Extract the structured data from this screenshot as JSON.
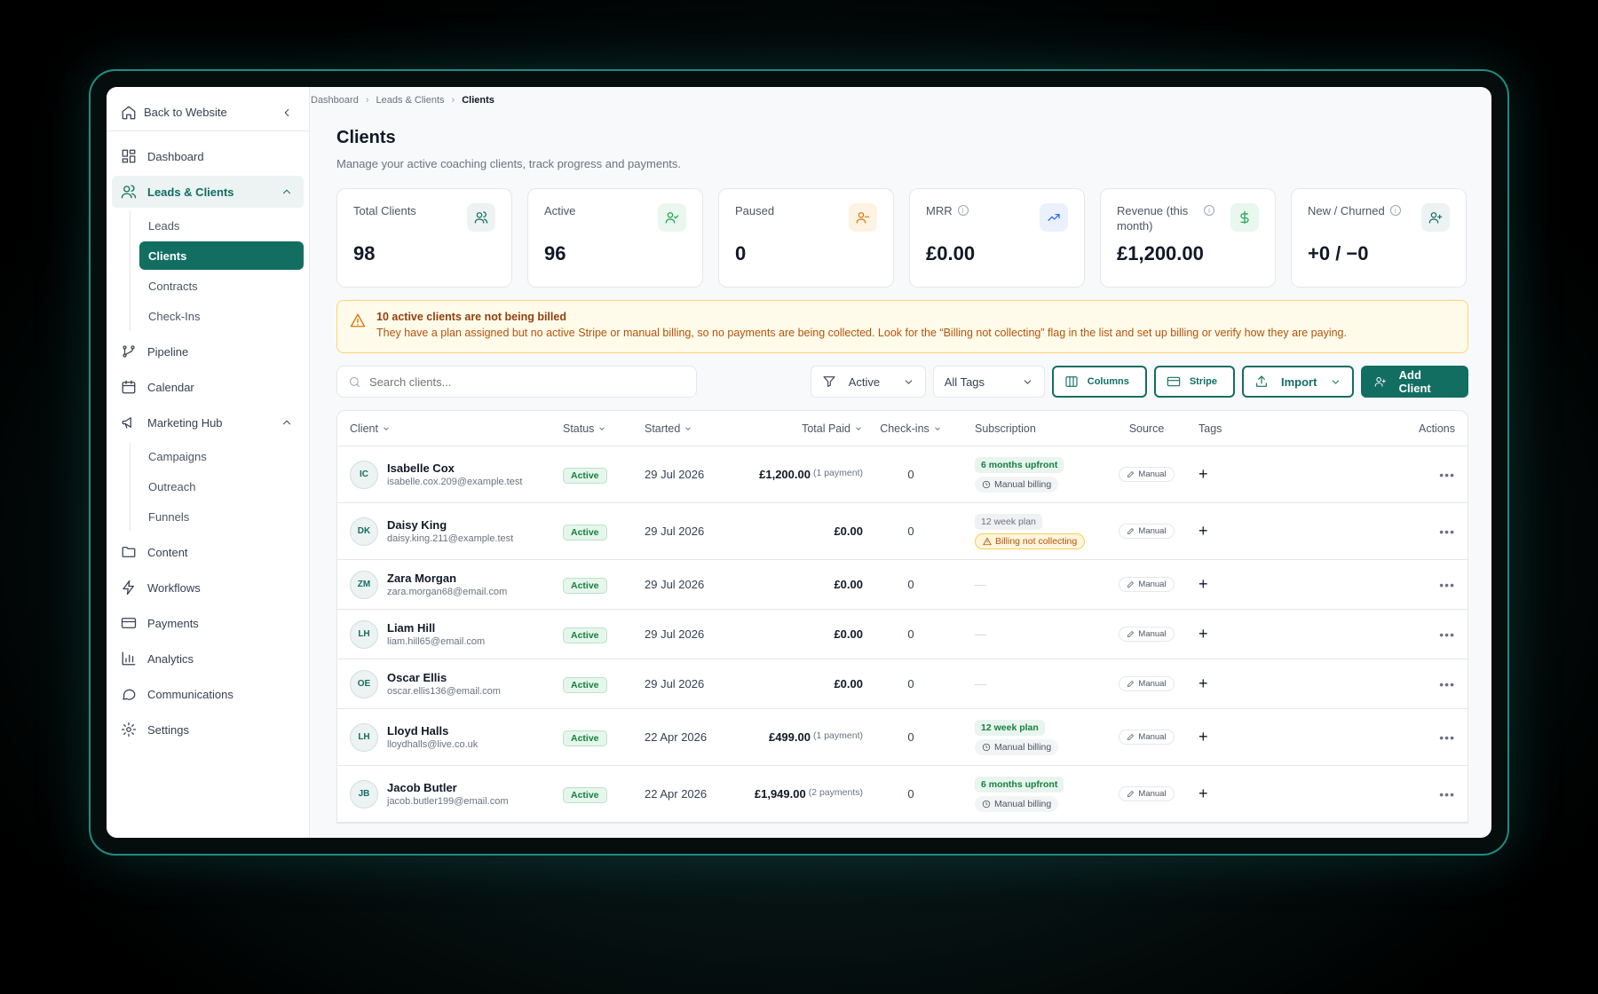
{
  "breadcrumb": [
    "Dashboard",
    "Leads & Clients",
    "Clients"
  ],
  "sidebar": {
    "back_label": "Back to Website",
    "items": [
      {
        "label": "Dashboard",
        "icon": "dashboard-icon"
      },
      {
        "label": "Leads & Clients",
        "icon": "users-icon",
        "open": true,
        "children": [
          "Leads",
          "Clients",
          "Contracts",
          "Check-Ins"
        ],
        "active_child": "Clients"
      },
      {
        "label": "Pipeline",
        "icon": "pipeline-icon"
      },
      {
        "label": "Calendar",
        "icon": "calendar-icon"
      },
      {
        "label": "Marketing Hub",
        "icon": "megaphone-icon",
        "children": [
          "Campaigns",
          "Outreach",
          "Funnels"
        ]
      },
      {
        "label": "Content",
        "icon": "folder-icon"
      },
      {
        "label": "Workflows",
        "icon": "lightning-icon"
      },
      {
        "label": "Payments",
        "icon": "card-icon"
      },
      {
        "label": "Analytics",
        "icon": "chart-icon"
      },
      {
        "label": "Communications",
        "icon": "chat-icon"
      },
      {
        "label": "Settings",
        "icon": "gear-icon"
      }
    ]
  },
  "page": {
    "title": "Clients",
    "subtitle": "Manage your active coaching clients, track progress and payments."
  },
  "stats": [
    {
      "label": "Total Clients",
      "value": "98",
      "icon": "users-icon",
      "color": "#136e62",
      "bg": "#ecf3f2"
    },
    {
      "label": "Active",
      "value": "96",
      "icon": "user-check-icon",
      "color": "#16a34a",
      "bg": "#e9f7ee"
    },
    {
      "label": "Paused",
      "value": "0",
      "icon": "user-minus-icon",
      "color": "#d97706",
      "bg": "#fef3e2"
    },
    {
      "label": "MRR",
      "value": "£0.00",
      "icon": "trend-up-icon",
      "color": "#2563eb",
      "bg": "#eaf1fd",
      "info": true
    },
    {
      "label": "Revenue (this month)",
      "value": "£1,200.00",
      "icon": "dollar-icon",
      "color": "#16a34a",
      "bg": "#e9f7ee",
      "info": true
    },
    {
      "label": "New / Churned",
      "value": "+0 / −0",
      "icon": "user-plus-icon",
      "color": "#136e62",
      "bg": "#ecf3f2",
      "info": true
    }
  ],
  "alert": {
    "title": "10 active clients are not being billed",
    "body": "They have a plan assigned but no active Stripe or manual billing, so no payments are being collected. Look for the “Billing not collecting” flag in the list and set up billing or verify how they are paying."
  },
  "toolbar": {
    "search_placeholder": "Search clients...",
    "status_filter": "Active",
    "tags_filter": "All Tags",
    "columns_label": "Columns",
    "stripe_label": "Stripe",
    "import_label": "Import",
    "add_label": "Add Client"
  },
  "columns": {
    "client": "Client",
    "status": "Status",
    "started": "Started",
    "paid": "Total Paid",
    "checkins": "Check-ins",
    "subscription": "Subscription",
    "source": "Source",
    "tags": "Tags",
    "actions": "Actions"
  },
  "rows": [
    {
      "initials": "IC",
      "name": "Isabelle Cox",
      "email": "isabelle.cox.209@example.test",
      "status": "Active",
      "started": "29 Jul 2026",
      "paid": "£1,200.00",
      "payments": "(1 payment)",
      "checkins": "0",
      "plan": "6 months upfront",
      "plan_style": "green",
      "billing": "Manual billing",
      "billing_style": "manual",
      "source": "Manual"
    },
    {
      "initials": "DK",
      "name": "Daisy King",
      "email": "daisy.king.211@example.test",
      "status": "Active",
      "started": "29 Jul 2026",
      "paid": "£0.00",
      "payments": "",
      "checkins": "0",
      "plan": "12 week plan",
      "plan_style": "grey",
      "billing": "Billing not collecting",
      "billing_style": "warn",
      "source": "Manual"
    },
    {
      "initials": "ZM",
      "name": "Zara Morgan",
      "email": "zara.morgan68@email.com",
      "status": "Active",
      "started": "29 Jul 2026",
      "paid": "£0.00",
      "payments": "",
      "checkins": "0",
      "plan": "",
      "billing": "",
      "source": "Manual"
    },
    {
      "initials": "LH",
      "name": "Liam Hill",
      "email": "liam.hill65@email.com",
      "status": "Active",
      "started": "29 Jul 2026",
      "paid": "£0.00",
      "payments": "",
      "checkins": "0",
      "plan": "",
      "billing": "",
      "source": "Manual"
    },
    {
      "initials": "OE",
      "name": "Oscar Ellis",
      "email": "oscar.ellis136@email.com",
      "status": "Active",
      "started": "29 Jul 2026",
      "paid": "£0.00",
      "payments": "",
      "checkins": "0",
      "plan": "",
      "billing": "",
      "source": "Manual"
    },
    {
      "initials": "LH",
      "name": "Lloyd Halls",
      "email": "lloydhalls@live.co.uk",
      "status": "Active",
      "started": "22 Apr 2026",
      "paid": "£499.00",
      "payments": "(1 payment)",
      "checkins": "0",
      "plan": "12 week plan",
      "plan_style": "green",
      "billing": "Manual billing",
      "billing_style": "manual",
      "source": "Manual"
    },
    {
      "initials": "JB",
      "name": "Jacob Butler",
      "email": "jacob.butler199@email.com",
      "status": "Active",
      "started": "22 Apr 2026",
      "paid": "£1,949.00",
      "payments": "(2 payments)",
      "checkins": "0",
      "plan": "6 months upfront",
      "plan_style": "green",
      "billing": "Manual billing",
      "billing_style": "manual",
      "source": "Manual"
    }
  ],
  "colors": {
    "accent": "#136e62",
    "frame": "#1e8c82",
    "warning": "#b45309"
  }
}
